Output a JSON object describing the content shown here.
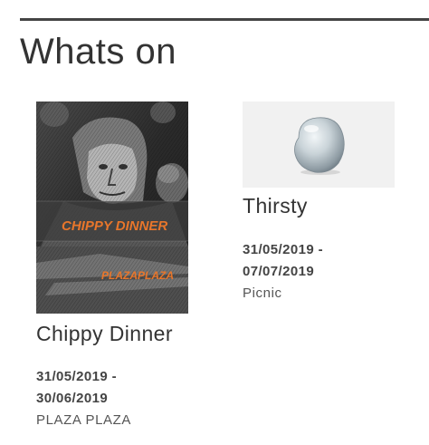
{
  "section": {
    "title": "Whats on"
  },
  "events": [
    {
      "title": "Chippy Dinner",
      "date_start": "31/05/2019 -",
      "date_end": "30/06/2019",
      "venue": "PLAZA PLAZA",
      "image_text_1": "CHIPPY DINNER",
      "image_text_2": "PLAZAPLAZA"
    },
    {
      "title": "Thirsty",
      "date_start": "31/05/2019 -",
      "date_end": "07/07/2019",
      "venue": "Picnic"
    }
  ],
  "colors": {
    "text": "#333333",
    "rule": "#444444",
    "poster_accent": "#e8762b",
    "thumb_bg": "#f1f1f1"
  }
}
